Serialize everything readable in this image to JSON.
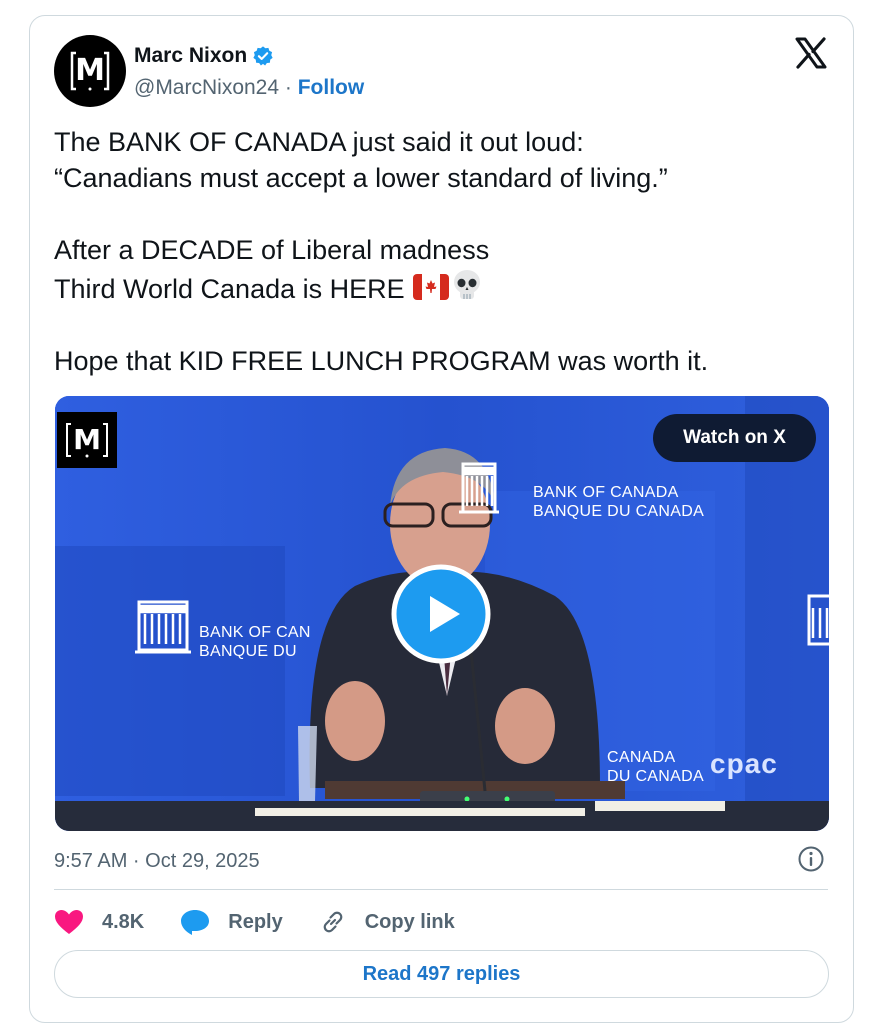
{
  "author": {
    "name": "Marc Nixon",
    "handle": "@MarcNixon24",
    "separator": " · ",
    "follow_label": "Follow",
    "avatar_letter": "M",
    "verified_color": "#1d9bf0"
  },
  "tweet": {
    "line1": "The BANK OF CANADA just said it out loud:",
    "line2": "“Canadians must accept a lower standard of living.”",
    "line3": "After a DECADE of Liberal madness",
    "line4": "Third World Canada is HERE",
    "line5": "Hope that KID FREE LUNCH PROGRAM was worth it.",
    "emojis": [
      "canada-flag-icon",
      "skull-icon"
    ]
  },
  "media": {
    "watch_label": "Watch on X",
    "watermark_letter": "M",
    "backdrop_label_1_line1": "BANK OF CANADA",
    "backdrop_label_1_line2": "BANQUE DU CANADA",
    "backdrop_label_2_line1": "BANK OF CAN",
    "backdrop_label_2_line2": "BANQUE DU",
    "backdrop_label_3_line1": "CANADA",
    "backdrop_label_3_line2": "DU CANADA",
    "broadcaster": "cpac",
    "backdrop_color": "#2a55d6"
  },
  "meta": {
    "timestamp": "9:57 AM · Oct 29, 2025"
  },
  "actions": {
    "like_count": "4.8K",
    "reply_label": "Reply",
    "copy_label": "Copy link",
    "read_replies_label": "Read 497 replies"
  },
  "colors": {
    "accent": "#1d76c9",
    "like": "#f91880",
    "muted": "#536471"
  }
}
